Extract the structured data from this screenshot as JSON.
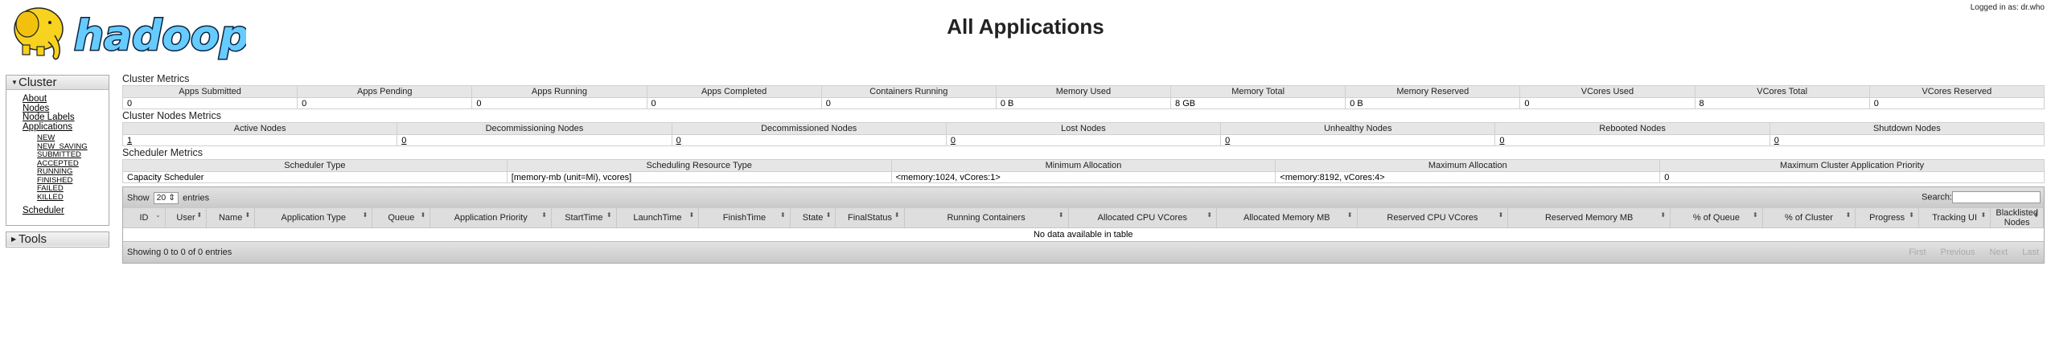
{
  "header": {
    "logo_text": "hadoop",
    "title": "All Applications",
    "user": "Logged in as: dr.who"
  },
  "nav": {
    "cluster": {
      "label": "Cluster",
      "links": [
        "About",
        "Nodes",
        "Node Labels",
        "Applications"
      ],
      "app_states": [
        "NEW",
        "NEW_SAVING",
        "SUBMITTED",
        "ACCEPTED",
        "RUNNING",
        "FINISHED",
        "FAILED",
        "KILLED"
      ],
      "scheduler": "Scheduler"
    },
    "tools": {
      "label": "Tools"
    }
  },
  "cluster_metrics": {
    "title": "Cluster Metrics",
    "headers": [
      "Apps Submitted",
      "Apps Pending",
      "Apps Running",
      "Apps Completed",
      "Containers Running",
      "Memory Used",
      "Memory Total",
      "Memory Reserved",
      "VCores Used",
      "VCores Total",
      "VCores Reserved"
    ],
    "values": [
      "0",
      "0",
      "0",
      "0",
      "0",
      "0 B",
      "8 GB",
      "0 B",
      "0",
      "8",
      "0"
    ]
  },
  "node_metrics": {
    "title": "Cluster Nodes Metrics",
    "headers": [
      "Active Nodes",
      "Decommissioning Nodes",
      "Decommissioned Nodes",
      "Lost Nodes",
      "Unhealthy Nodes",
      "Rebooted Nodes",
      "Shutdown Nodes"
    ],
    "values": [
      "1",
      "0",
      "0",
      "0",
      "0",
      "0",
      "0"
    ]
  },
  "scheduler_metrics": {
    "title": "Scheduler Metrics",
    "headers": [
      "Scheduler Type",
      "Scheduling Resource Type",
      "Minimum Allocation",
      "Maximum Allocation",
      "Maximum Cluster Application Priority"
    ],
    "values": [
      "Capacity Scheduler",
      "[memory-mb (unit=Mi), vcores]",
      "<memory:1024, vCores:1>",
      "<memory:8192, vCores:4>",
      "0"
    ]
  },
  "apps_table": {
    "show_label": "Show",
    "length_value": "20",
    "entries_label": "entries",
    "search_label": "Search:",
    "search_value": "",
    "columns": [
      "ID",
      "User",
      "Name",
      "Application Type",
      "Queue",
      "Application Priority",
      "StartTime",
      "LaunchTime",
      "FinishTime",
      "State",
      "FinalStatus",
      "Running Containers",
      "Allocated CPU VCores",
      "Allocated Memory MB",
      "Reserved CPU VCores",
      "Reserved Memory MB",
      "% of Queue",
      "% of Cluster",
      "Progress",
      "Tracking UI",
      "Blacklisted Nodes"
    ],
    "empty_message": "No data available in table",
    "info": "Showing 0 to 0 of 0 entries",
    "pager": [
      "First",
      "Previous",
      "Next",
      "Last"
    ]
  }
}
